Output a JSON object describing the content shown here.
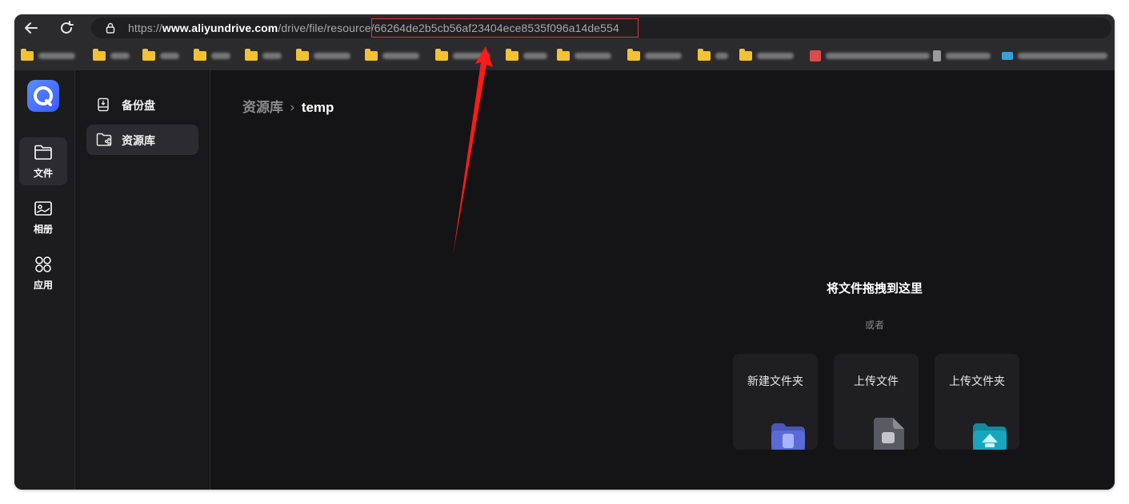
{
  "browser": {
    "url_scheme": "https://",
    "url_host": "www.aliyundrive.com",
    "url_path": "/drive/file/resource/",
    "url_id": "66264de2b5cb56af23404ece8535f096a14de554"
  },
  "rail": {
    "items": [
      {
        "label": "文件",
        "icon": "folder-icon"
      },
      {
        "label": "相册",
        "icon": "photo-icon"
      },
      {
        "label": "应用",
        "icon": "apps-icon"
      }
    ]
  },
  "sidebar": {
    "items": [
      {
        "label": "备份盘",
        "icon": "backup-drive-icon"
      },
      {
        "label": "资源库",
        "icon": "resource-folder-icon"
      }
    ]
  },
  "main": {
    "breadcrumb": {
      "parent": "资源库",
      "separator": "›",
      "current": "temp"
    },
    "drop_title": "将文件拖拽到这里",
    "drop_or": "或者",
    "actions": [
      {
        "label": "新建文件夹",
        "icon": "new-folder-icon"
      },
      {
        "label": "上传文件",
        "icon": "upload-file-icon"
      },
      {
        "label": "上传文件夹",
        "icon": "upload-folder-icon"
      }
    ]
  },
  "colors": {
    "accent": "#3b5bff",
    "annotation": "#ff1a1a"
  }
}
